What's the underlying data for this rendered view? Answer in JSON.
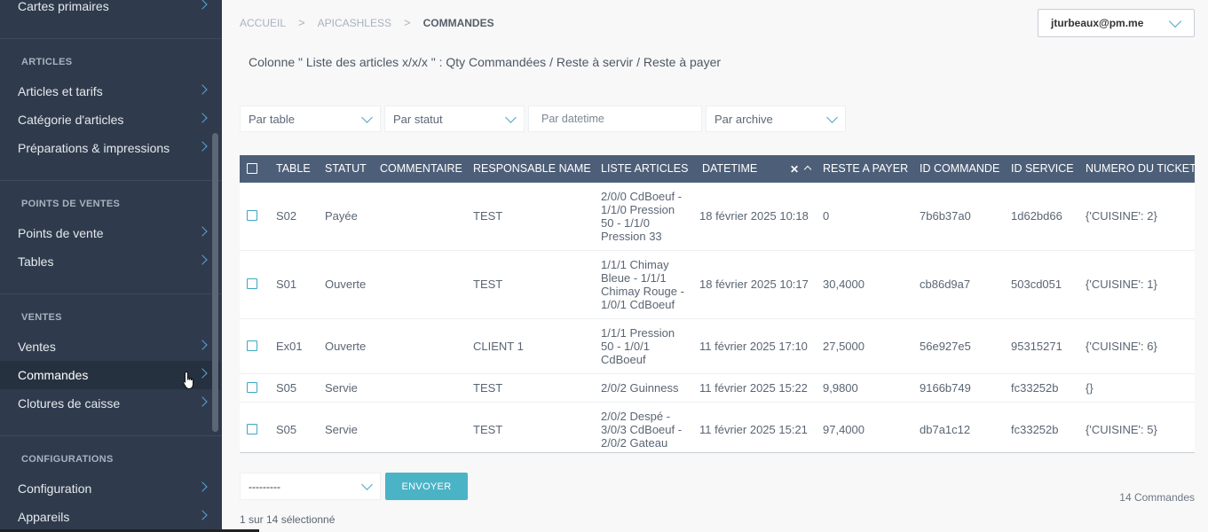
{
  "sidebar": {
    "sections": [
      {
        "heading": "",
        "items": [
          {
            "label": "Cartes primaires"
          }
        ]
      },
      {
        "heading": "ARTICLES",
        "items": [
          {
            "label": "Articles et tarifs"
          },
          {
            "label": "Catégorie d'articles"
          },
          {
            "label": "Préparations & impressions"
          }
        ]
      },
      {
        "heading": "POINTS DE VENTES",
        "items": [
          {
            "label": "Points de vente"
          },
          {
            "label": "Tables"
          }
        ]
      },
      {
        "heading": "VENTES",
        "items": [
          {
            "label": "Ventes"
          },
          {
            "label": "Commandes"
          },
          {
            "label": "Clotures de caisse"
          }
        ]
      },
      {
        "heading": "CONFIGURATIONS",
        "items": [
          {
            "label": "Configuration"
          },
          {
            "label": "Appareils"
          }
        ]
      }
    ]
  },
  "breadcrumb": {
    "home": "ACCUEIL",
    "app": "APICASHLESS",
    "current": "COMMANDES"
  },
  "user": {
    "email": "jturbeaux@pm.me"
  },
  "description": "Colonne \" Liste des articles x/x/x \" : Qty Commandées / Reste à servir / Reste à payer",
  "filters": {
    "table": "Par table",
    "status": "Par statut",
    "datetime": "Par datetime",
    "archive": "Par archive"
  },
  "table": {
    "columns": [
      "TABLE",
      "STATUT",
      "COMMENTAIRE",
      "RESPONSABLE NAME",
      "LISTE ARTICLES",
      "DATETIME",
      "RESTE A PAYER",
      "ID COMMANDE",
      "ID SERVICE",
      "NUMERO DU TICKET"
    ],
    "sort_clear": "✕",
    "rows": [
      {
        "table": "S02",
        "statut": "Payée",
        "commentaire": "",
        "responsable": "TEST",
        "articles": "2/0/0 CdBoeuf - 1/1/0 Pression 50 - 1/1/0 Pression 33",
        "datetime": "18 février 2025 10:18",
        "reste": "0",
        "id_commande": "7b6b37a0",
        "id_service": "1d62bd66",
        "ticket": "{'CUISINE': 2}"
      },
      {
        "table": "S01",
        "statut": "Ouverte",
        "commentaire": "",
        "responsable": "TEST",
        "articles": "1/1/1 Chimay Bleue - 1/1/1 Chimay Rouge - 1/0/1 CdBoeuf",
        "datetime": "18 février 2025 10:17",
        "reste": "30,4000",
        "id_commande": "cb86d9a7",
        "id_service": "503cd051",
        "ticket": "{'CUISINE': 1}"
      },
      {
        "table": "Ex01",
        "statut": "Ouverte",
        "commentaire": "",
        "responsable": "CLIENT 1",
        "articles": "1/1/1 Pression 50 - 1/0/1 CdBoeuf",
        "datetime": "11 février 2025 17:10",
        "reste": "27,5000",
        "id_commande": "56e927e5",
        "id_service": "95315271",
        "ticket": "{'CUISINE': 6}"
      },
      {
        "table": "S05",
        "statut": "Servie",
        "commentaire": "",
        "responsable": "TEST",
        "articles": "2/0/2 Guinness",
        "datetime": "11 février 2025 15:22",
        "reste": "9,9800",
        "id_commande": "9166b749",
        "id_service": "fc33252b",
        "ticket": "{}"
      },
      {
        "table": "S05",
        "statut": "Servie",
        "commentaire": "",
        "responsable": "TEST",
        "articles": "2/0/2 Despé - 3/0/3 CdBoeuf - 2/0/2 Gateau",
        "datetime": "11 février 2025 15:21",
        "reste": "97,4000",
        "id_commande": "db7a1c12",
        "id_service": "fc33252b",
        "ticket": "{'CUISINE': 5}"
      }
    ]
  },
  "actions": {
    "select_value": "---------",
    "send_label": "ENVOYER"
  },
  "footer": {
    "count": "14 Commandes",
    "selected": "1 sur 14 sélectionné"
  }
}
